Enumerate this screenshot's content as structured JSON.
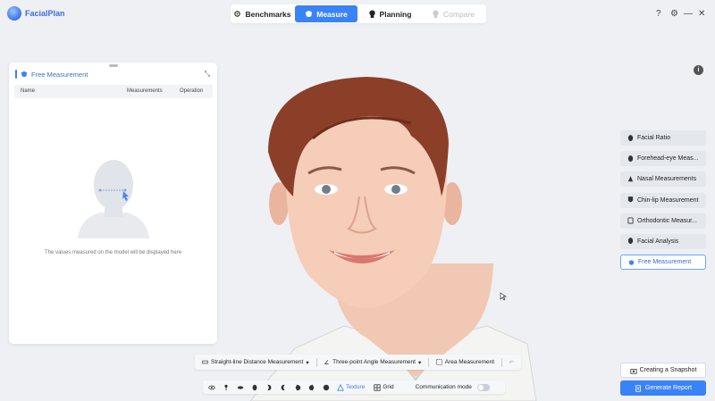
{
  "app": {
    "name": "FacialPlan"
  },
  "tabs": [
    {
      "label": "Benchmarks"
    },
    {
      "label": "Measure"
    },
    {
      "label": "Planning"
    },
    {
      "label": "Compare"
    }
  ],
  "window_controls": {
    "help": "?",
    "settings": "⚙",
    "minimize": "—",
    "close": "✕"
  },
  "left_panel": {
    "title": "Free Measurement",
    "columns": [
      "Name",
      "Measurements",
      "Operation"
    ],
    "empty_text": "The values measured on the model will be displayed here"
  },
  "right_menu": {
    "items": [
      {
        "label": "Facial Ratio",
        "icon": "face-icon"
      },
      {
        "label": "Forehead-eye Meas...",
        "icon": "face-icon"
      },
      {
        "label": "Nasal Measurements",
        "icon": "nose-icon"
      },
      {
        "label": "Chin-lip Measurement",
        "icon": "chin-icon"
      },
      {
        "label": "Orthodontic Measur...",
        "icon": "teeth-icon"
      },
      {
        "label": "Facial Analysis",
        "icon": "face-icon"
      },
      {
        "label": "Free Measurement",
        "icon": "shield-icon"
      }
    ],
    "snapshot_label": "Creating a Snapshot",
    "report_label": "Generate Report"
  },
  "measure_toolbar": {
    "straight": "Straight-line Distance Measurement",
    "angle": "Three-point Angle Measurement",
    "area": "Area Measurement"
  },
  "view_toolbar": {
    "texture": "Texture",
    "grid": "Grid",
    "communication": "Communication mode"
  },
  "colors": {
    "accent": "#3a82f7",
    "background": "#eef0f4"
  }
}
